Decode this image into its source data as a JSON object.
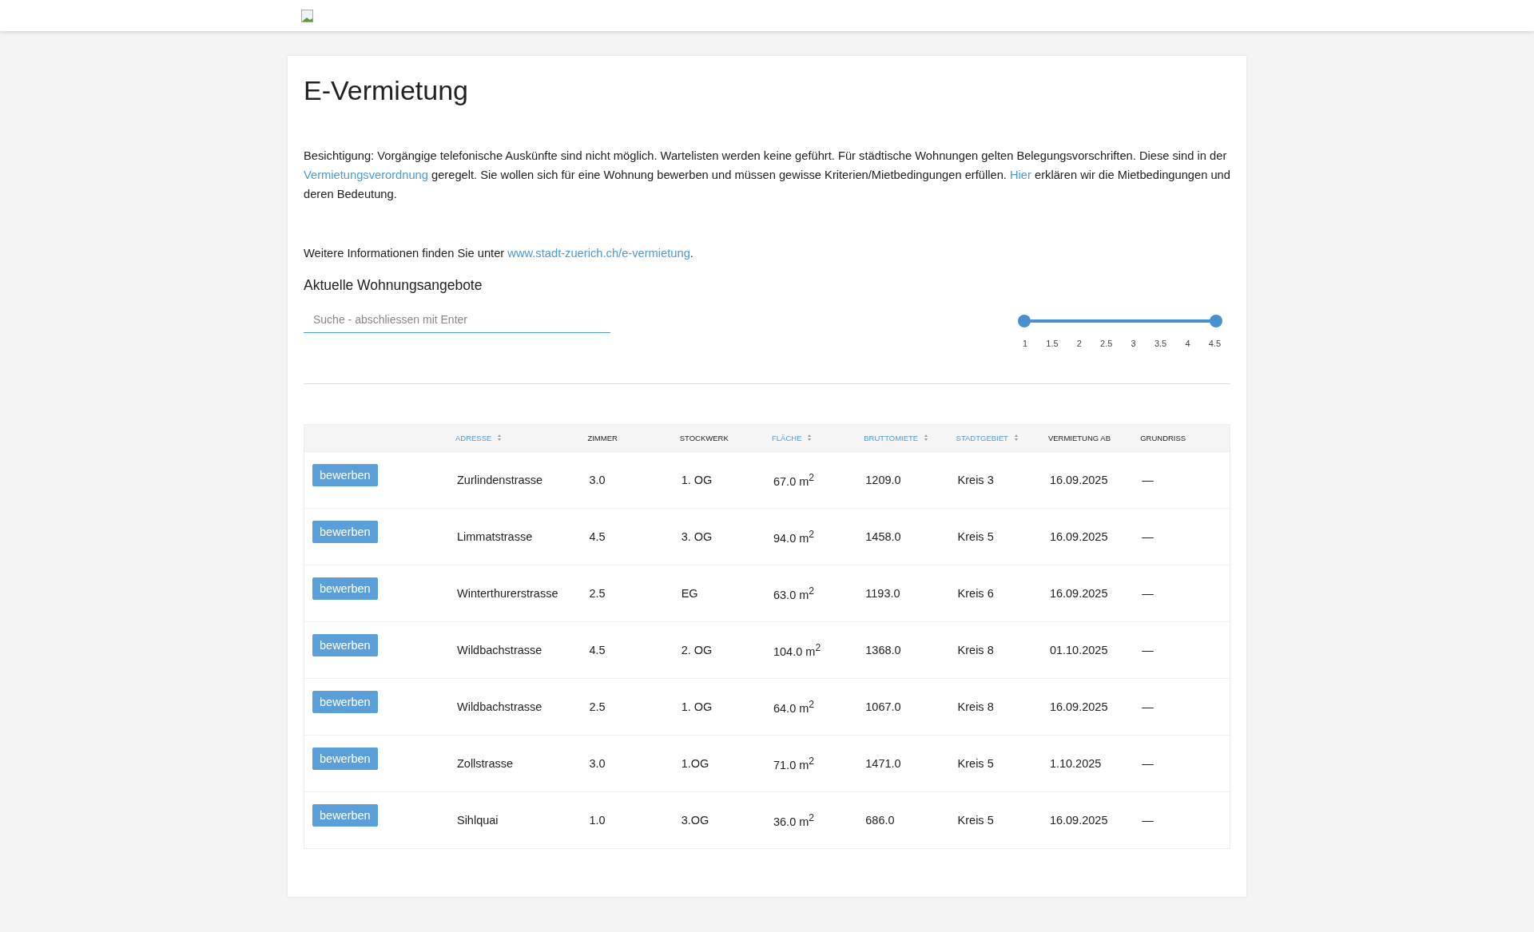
{
  "title": "E-Vermietung",
  "intro": [
    {
      "kind": "text",
      "text": "Besichtigung: Vorgängige telefonische Auskünfte sind nicht möglich. Wartelisten werden keine geführt. Für städtische Wohnungen gelten Belegungsvorschriften. Diese sind in der "
    },
    {
      "kind": "link",
      "text": "Vermietungsverordnung"
    },
    {
      "kind": "text",
      "text": " geregelt. Sie wollen sich für eine Wohnung bewerben und müssen gewisse Kriterien/Mietbedingungen erfüllen. "
    },
    {
      "kind": "link",
      "text": "Hier"
    },
    {
      "kind": "text",
      "text": " erklären wir die Mietbedingungen und deren Bedeutung."
    }
  ],
  "info": [
    {
      "kind": "text",
      "text": "Weitere Informationen finden Sie unter "
    },
    {
      "kind": "link",
      "text": "www.stadt-zuerich.ch/e-vermietung"
    },
    {
      "kind": "text",
      "text": "."
    }
  ],
  "section_title": "Aktuelle Wohnungsangebote",
  "search": {
    "placeholder": "Suche - abschliessen mit Enter"
  },
  "room_slider": {
    "thumbs": [
      {
        "level": 0
      },
      {
        "level": 1
      }
    ],
    "ticks": [
      "1",
      "1.5",
      "2",
      "2.5",
      "3",
      "3.5",
      "4",
      "4.5"
    ]
  },
  "table": {
    "columns": [
      {
        "label": "ADRESSE",
        "sortable": true
      },
      {
        "label": "ZIMMER",
        "sortable": false
      },
      {
        "label": "STOCKWERK",
        "sortable": false
      },
      {
        "label": "FLÄCHE",
        "sortable": true
      },
      {
        "label": "BRUTTOMIETE",
        "sortable": true
      },
      {
        "label": "STADTGEBIET",
        "sortable": true
      },
      {
        "label": "VERMIETUNG AB",
        "sortable": false
      },
      {
        "label": "GRUNDRISS",
        "sortable": false
      }
    ],
    "rows": [
      {
        "action": "bewerben",
        "cells": [
          "Zurlindenstrasse",
          "3.0",
          "1. OG",
          "67.0 m$^{2}$",
          "1209.0",
          "Kreis 3",
          "16.09.2025",
          "—"
        ]
      },
      {
        "action": "bewerben",
        "cells": [
          "Limmatstrasse",
          "4.5",
          "3. OG",
          "94.0 m$^{2}$",
          "1458.0",
          "Kreis 5",
          "16.09.2025",
          "—"
        ]
      },
      {
        "action": "bewerben",
        "cells": [
          "Winterthurerstrasse",
          "2.5",
          "EG",
          "63.0 m$^{2}$",
          "1193.0",
          "Kreis 6",
          "16.09.2025",
          "—"
        ]
      },
      {
        "action": "bewerben",
        "cells": [
          "Wildbachstrasse",
          "4.5",
          "2. OG",
          "104.0 m$^{2}$",
          "1368.0",
          "Kreis 8",
          "01.10.2025",
          "—"
        ]
      },
      {
        "action": "bewerben",
        "cells": [
          "Wildbachstrasse",
          "2.5",
          "1. OG",
          "64.0 m$^{2}$",
          "1067.0",
          "Kreis 8",
          "16.09.2025",
          "—"
        ]
      },
      {
        "action": "bewerben",
        "cells": [
          "Zollstrasse",
          "3.0",
          "1.OG",
          "71.0 m$^{2}$",
          "1471.0",
          "Kreis 5",
          "1.10.2025",
          "—"
        ]
      },
      {
        "action": "bewerben",
        "cells": [
          "Sihlquai",
          "1.0",
          "3.OG",
          "36.0 m$^{2}$",
          "686.0",
          "Kreis 5",
          "16.09.2025",
          "—"
        ]
      }
    ]
  }
}
